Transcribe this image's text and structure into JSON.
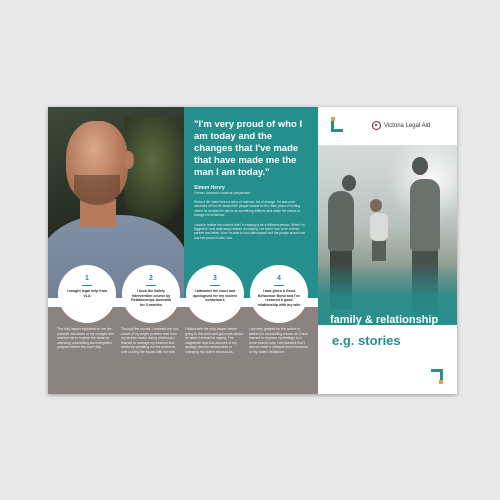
{
  "quote": {
    "text": "\"I'm very proud of who I am today and the changes that I've made that have made me the man I am today.\"",
    "name": "Simon Henry",
    "role": "Former domestic violence perpetrator",
    "body_1": "Simon's life hasn't been a story of violence, but of change. He was once ashamed of how he treated the people closest to him. After years of hurting others he decided he had to do something different and made the choice to change his behaviour.",
    "body_2": "I want to realise the choices that I'm making to be a different person. When I'm triggered I now walk away instead of reacting. I've learnt how to be a better partner and father. Now I'm able to look after myself and the people around me and feel proud of who I am."
  },
  "steps": [
    {
      "number": "1",
      "text": "I sought legal help from VLA",
      "body": "The duty lawyer explained to me the possible outcomes of my charges and advised me to explore the issue by attending counselling and integrated program before the court day."
    },
    {
      "number": "2",
      "text": "I took the Safety Intervention course by Relationships Australia for 3 months",
      "body": "Through the course, I realised the root cause of my anger problem was from my broken family during childhood. I learned to manage my emotion and stress by speaking out the problems over solving the issues with my wife."
    },
    {
      "number": "3",
      "text": "I attended the court and apologised for my violent behaviours",
      "body": "I talked with the duty lawyer before going to the court and got some advice on what it should be saying. The magistrate took into account of my apology and the seriousness in changing my violent behaviours."
    },
    {
      "number": "4",
      "text": "I was given a Good Behaviour Bond and I've restored a good relationship with my wife",
      "body": "I am very grateful for the advice to attend the counselling course as I have learned to express my feelings in a more mature way. I am thankful that I did not leave a criminal record because of my violent behaviour."
    }
  ],
  "brand": {
    "logo_text": "Victoria Legal Aid"
  },
  "right_panel": {
    "category": "family & relationship",
    "heading": "e.g. stories"
  },
  "colors": {
    "teal": "#248f8d",
    "accent_orange": "#e5a23a",
    "band_gray": "#8a8380",
    "brand_maroon": "#8a1538"
  }
}
